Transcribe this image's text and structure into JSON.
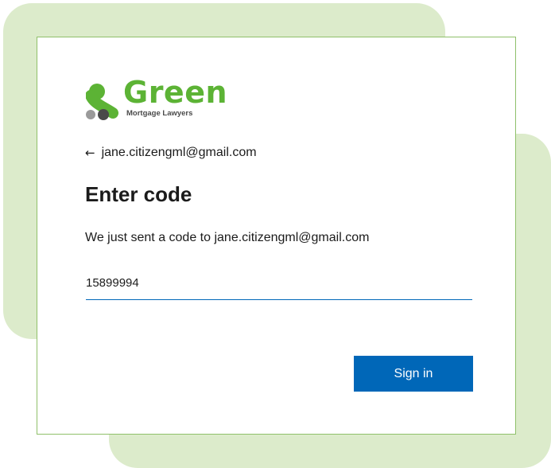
{
  "logo": {
    "word": "Green",
    "subtitle": "Mortgage Lawyers",
    "icon": "green-logo-icon"
  },
  "back": {
    "icon": "arrow-left-icon",
    "email": "jane.citizengml@gmail.com"
  },
  "title": "Enter code",
  "description": "We just sent a code to jane.citizengml@gmail.com",
  "code_input": {
    "value": "15899994"
  },
  "sign_in": {
    "label": "Sign in"
  },
  "colors": {
    "accent": "#0067b8",
    "brand_green": "#5cb335",
    "background_blob": "#dcebcb",
    "card_border": "#8fc06a"
  }
}
